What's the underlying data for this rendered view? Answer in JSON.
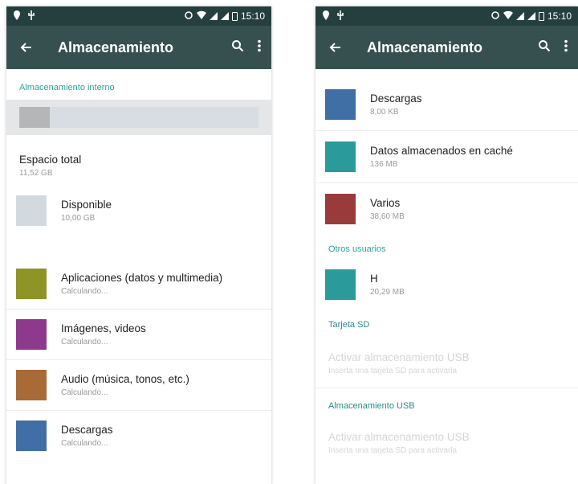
{
  "left": {
    "status": {
      "time": "15:10"
    },
    "toolbar": {
      "title": "Almacenamiento"
    },
    "section_internal": "Almacenamiento interno",
    "total": {
      "label": "Espacio total",
      "value": "11,52 GB"
    },
    "available": {
      "label": "Disponible",
      "value": "10,00 GB",
      "color": "#d3dadf"
    },
    "items": [
      {
        "label": "Aplicaciones (datos y multimedia)",
        "value": "Calculando...",
        "color": "#8e9425"
      },
      {
        "label": "Imágenes, videos",
        "value": "Calculando...",
        "color": "#8e3a8c"
      },
      {
        "label": "Audio (música, tonos, etc.)",
        "value": "Calculando...",
        "color": "#a86a36"
      },
      {
        "label": "Descargas",
        "value": "Calculando...",
        "color": "#3f6fa5"
      }
    ]
  },
  "right": {
    "status": {
      "time": "15:10"
    },
    "toolbar": {
      "title": "Almacenamiento"
    },
    "items": [
      {
        "label": "Descargas",
        "value": "8,00 KB",
        "color": "#3f6fa5"
      },
      {
        "label": "Datos almacenados en caché",
        "value": "136 MB",
        "color": "#2a9a9a"
      },
      {
        "label": "Varios",
        "value": "38,60 MB",
        "color": "#9a3b3b"
      }
    ],
    "section_users": "Otros usuarios",
    "user": {
      "label": "H",
      "value": "20,29 MB",
      "color": "#2a9a9a"
    },
    "section_sd": "Tarjeta SD",
    "sd_action": {
      "label": "Activar almacenamiento USB",
      "value": "Inserta una tarjeta SD para activarla"
    },
    "section_usb": "Almacenamiento USB",
    "usb_action": {
      "label": "Activar almacenamiento USB",
      "value": "Inserta una tarjeta SD para activarla"
    }
  }
}
